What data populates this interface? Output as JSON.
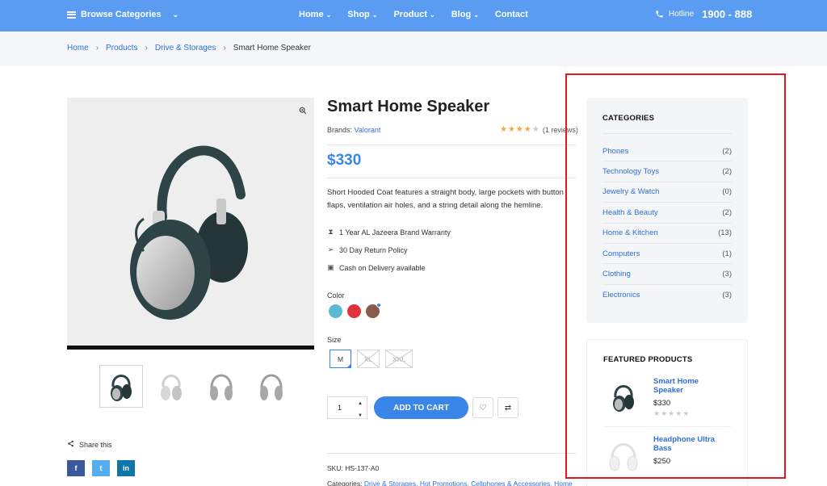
{
  "topnav": {
    "browse_label": "Browse Categories",
    "links": [
      "Home",
      "Shop",
      "Product",
      "Blog",
      "Contact"
    ],
    "hotline_label": "Hotline",
    "hotline_number": "1900 - 888"
  },
  "breadcrumb": {
    "items": [
      "Home",
      "Products",
      "Drive & Storages",
      "Smart Home Speaker"
    ],
    "separator": "›"
  },
  "product": {
    "title": "Smart Home Speaker",
    "brands_label": "Brands:",
    "brand": "Valorant",
    "rating": 4,
    "rating_stars": "★★★★★",
    "reviews": "(1 reviews)",
    "price": "$330",
    "description": "Short Hooded Coat features a straight body, large pockets with button flaps, ventilation air holes, and a string detail along the hemline.",
    "features": [
      "1 Year AL Jazeera Brand Warranty",
      "30 Day Return Policy",
      "Cash on Delivery available"
    ],
    "color_label": "Color",
    "colors": [
      "#5fb7d6",
      "#e0323c",
      "#8a5a4c"
    ],
    "size_label": "Size",
    "sizes": [
      "M",
      "XL",
      "XXL"
    ],
    "quantity": "1",
    "add_to_cart": "ADD TO CART",
    "share_label": "Share this",
    "social": [
      "f",
      "t",
      "in"
    ],
    "sku_label": "SKU:",
    "sku": "HS-137-A0",
    "categories_label": "Categories:",
    "categories": "Drive & Storages, Hot Promotions, Cellphones & Accessories, Home"
  },
  "sidebar": {
    "categories_title": "CATEGORIES",
    "categories": [
      {
        "name": "Phones",
        "count": "(2)"
      },
      {
        "name": "Technology Toys",
        "count": "(2)"
      },
      {
        "name": "Jewelry & Watch",
        "count": "(0)"
      },
      {
        "name": "Health & Beauty",
        "count": "(2)"
      },
      {
        "name": "Home & Kitchen",
        "count": "(13)"
      },
      {
        "name": "Computers",
        "count": "(1)"
      },
      {
        "name": "Clothing",
        "count": "(3)"
      },
      {
        "name": "Electronics",
        "count": "(3)"
      }
    ],
    "featured_title": "FEATURED PRODUCTS",
    "featured": [
      {
        "name": "Smart Home Speaker",
        "price": "$330",
        "stars": "★★★★★"
      },
      {
        "name": "Headphone Ultra Bass",
        "price": "$250",
        "stars": "★★★★★"
      }
    ]
  },
  "colors": {
    "nav_bg": "#5a9cf2",
    "accent": "#3a86e8",
    "link": "#2f6fd8",
    "highlight_frame": "#e0191f",
    "star": "#f0a834"
  }
}
